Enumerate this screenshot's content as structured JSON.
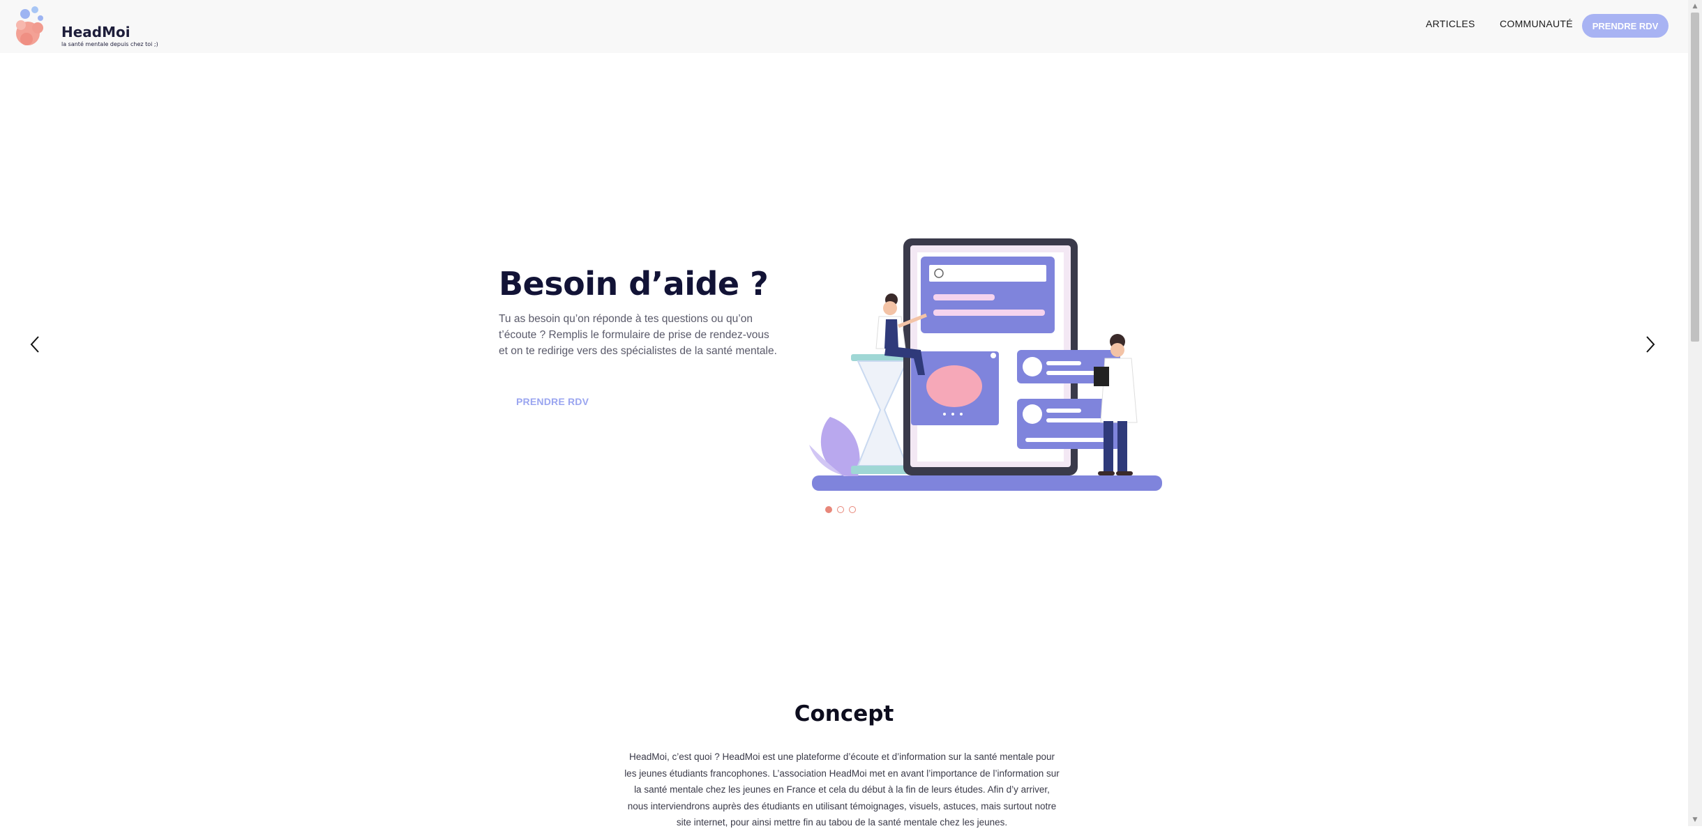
{
  "brand": {
    "name": "HeadMoi",
    "tagline": "la santé mentale depuis chez toi ;)"
  },
  "nav": {
    "articles": "ARTICLES",
    "community": "COMMUNAUTÉ",
    "cta": "PRENDRE RDV"
  },
  "hero": {
    "title": "Besoin d’aide ?",
    "text": "Tu as besoin qu’on réponde à tes questions ou qu’on t’écoute ? Remplis le formulaire de prise de rendez-vous et on te redirige vers des spécialistes de la santé mentale.",
    "cta": "PRENDRE RDV",
    "slide_count": 3,
    "active_slide": 1
  },
  "concept": {
    "title": "Concept",
    "text": "HeadMoi, c’est quoi ? HeadMoi est une plateforme d’écoute et d’information sur la santé mentale pour les jeunes étudiants francophones. L’association HeadMoi met en avant l’importance de l’information sur la santé mentale chez les jeunes en France et cela du début à la fin de leurs études. Afin d’y arriver, nous interviendrons auprès des étudiants en utilisant témoignages, visuels, astuces, mais surtout notre site internet, pour ainsi mettre fin au tabou de la santé mentale chez les jeunes."
  },
  "icons": {
    "prev": "chevron-left-icon",
    "next": "chevron-right-icon"
  },
  "colors": {
    "accent": "#a8b3f3",
    "title": "#121336",
    "dot": "#e8877a",
    "illustration_purple": "#7f84dc"
  }
}
